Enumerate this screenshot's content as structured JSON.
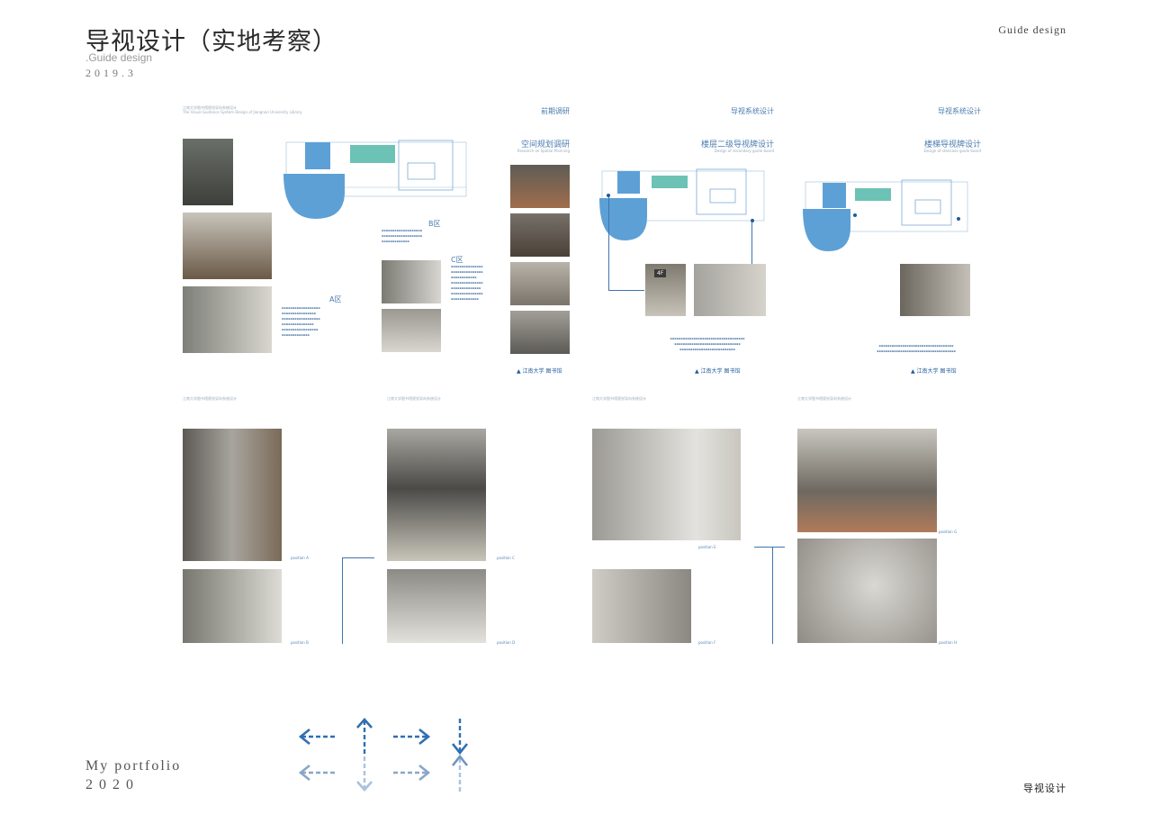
{
  "header": {
    "title": "导视设计（实地考察）",
    "subtitle": ".Guide design",
    "date": "2019.3",
    "right_label": "Guide design"
  },
  "footer": {
    "portfolio": "My portfolio",
    "year": "2020",
    "right_label": "导视设计"
  },
  "pages": {
    "p1": {
      "running_header": "江南大学图书馆视觉导向系统设计",
      "running_header_en": "The Visual Guidance System Design of Jiangnan University Library",
      "zone_a": "A区",
      "zone_b": "B区",
      "zone_c": "C区",
      "section_right": "前期调研",
      "heading": "空间规划调研",
      "heading_en": "Research on Spatial Planning"
    },
    "p2": {
      "section_right": "导视系统设计",
      "heading": "楼层二级导视牌设计",
      "heading_en": "Design of secondary guide board",
      "sign_text": "4F"
    },
    "p3": {
      "section_right": "导视系统设计",
      "heading": "楼梯导视牌设计",
      "heading_en": "Design of staircase guide board"
    },
    "logo_text": "江南大学",
    "logo_sub": "图书馆",
    "photo_row": {
      "running_header": "江南大学图书馆视觉导向系统设计",
      "running_header_en": "The Visual Guidance System Design of Jiangnan University Library",
      "captions": [
        "position A",
        "position B",
        "position C",
        "position D",
        "position E",
        "position F",
        "position G",
        "position H"
      ]
    }
  },
  "arrows": {
    "colors": {
      "dark": "#2f6fb3",
      "mid": "#6f95c2",
      "light": "#a9c2de"
    }
  }
}
